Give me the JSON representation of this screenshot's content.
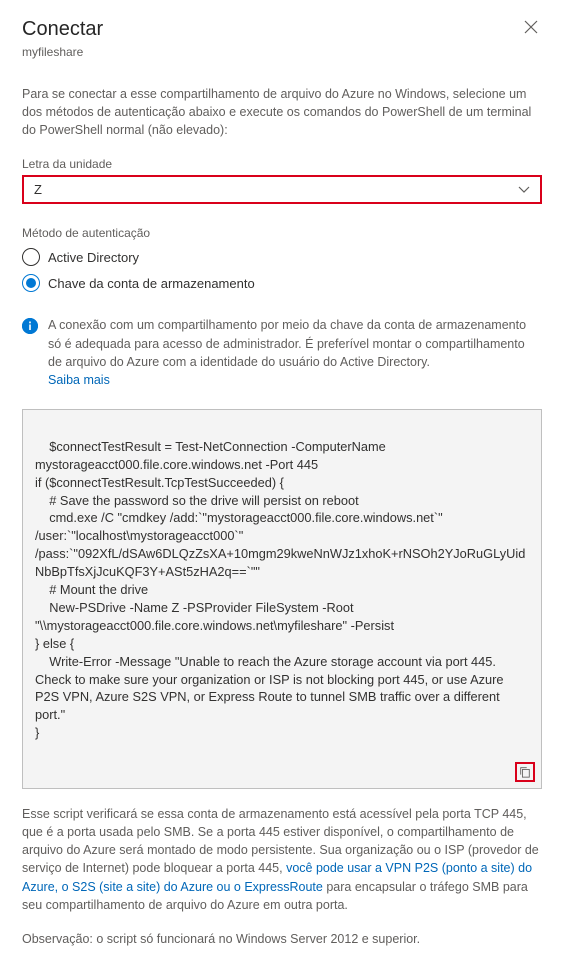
{
  "header": {
    "title": "Conectar",
    "subtitle": "myfileshare"
  },
  "intro": "Para se conectar a esse compartilhamento de arquivo do Azure no Windows, selecione um dos métodos de autenticação abaixo e execute os comandos do PowerShell de um terminal do PowerShell normal (não elevado):",
  "drive": {
    "label": "Letra da unidade",
    "value": "Z"
  },
  "auth": {
    "label": "Método de autenticação",
    "option1": "Active Directory",
    "option2": "Chave da conta de armazenamento"
  },
  "info": {
    "line1": "A conexão com um compartilhamento por meio da chave da conta de armazenamento só é adequada para acesso de administrador.",
    "line2": "É preferível montar o compartilhamento de arquivo do Azure com a identidade do usuário do Active Directory.",
    "learn": "Saiba mais"
  },
  "script": "$connectTestResult = Test-NetConnection -ComputerName mystorageacct000.file.core.windows.net -Port 445\nif ($connectTestResult.TcpTestSucceeded) {\n    # Save the password so the drive will persist on reboot\n    cmd.exe /C \"cmdkey /add:`\"mystorageacct000.file.core.windows.net`\" /user:`\"localhost\\mystorageacct000`\" /pass:`\"092XfL/dSAw6DLQzZsXA+10mgm29kweNnWJz1xhoK+rNSOh2YJoRuGLyUidNbBpTfsXjJcuKQF3Y+ASt5zHA2q==`\"\"\n    # Mount the drive\n    New-PSDrive -Name Z -PSProvider FileSystem -Root \"\\\\mystorageacct000.file.core.windows.net\\myfileshare\" -Persist\n} else {\n    Write-Error -Message \"Unable to reach the Azure storage account via port 445. Check to make sure your organization or ISP is not blocking port 445, or use Azure P2S VPN, Azure S2S VPN, or Express Route to tunnel SMB traffic over a different port.\"\n}",
  "footer": {
    "p1a": "Esse script verificará se essa conta de armazenamento está acessível pela porta TCP 445, que é a porta usada pelo SMB. Se a porta 445 estiver disponível, o compartilhamento de arquivo do Azure será montado de modo persistente. Sua organização ou o ISP (provedor de serviço de Internet) pode bloquear a porta 445, ",
    "p1link": "você pode usar a VPN P2S (ponto a site) do Azure, o S2S (site a site) do Azure ou o ExpressRoute",
    "p1b": " para encapsular o tráfego SMB para seu compartilhamento de arquivo do Azure em outra porta.",
    "note": "Observação: o script só funcionará no Windows Server 2012 e superior."
  }
}
